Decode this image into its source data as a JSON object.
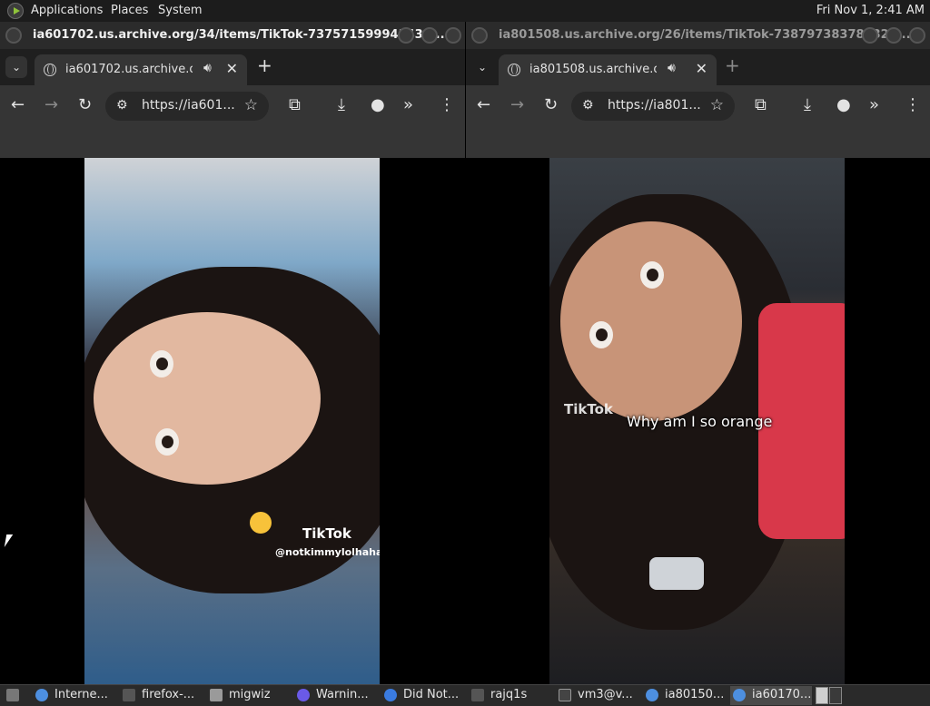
{
  "topbar": {
    "menus": [
      "Applications",
      "Places",
      "System"
    ],
    "clock": "Fri Nov 1, 2:41 AM"
  },
  "left_window": {
    "title": "ia601702.us.archive.org/34/items/TikTok-737571599941430...",
    "tab_label": "ia601702.us.archive.org/3",
    "url": "https://ia601...",
    "video": {
      "watermark": "TikTok",
      "handle": "@notkimmylolhaha"
    }
  },
  "right_window": {
    "title": "ia801508.us.archive.org/26/items/TikTok-738797383789324...",
    "tab_label": "ia801508.us.archive.org/",
    "url": "https://ia801...",
    "video": {
      "watermark": "TikTok",
      "caption": "Why am I so orange"
    }
  },
  "taskbar": {
    "items": [
      {
        "label": "Interne...",
        "icon": "chrome-icon"
      },
      {
        "label": "firefox-...",
        "icon": "terminal-icon"
      },
      {
        "label": "migwiz",
        "icon": "folder-icon"
      },
      {
        "label": "Warnin...",
        "icon": "firefox-icon"
      },
      {
        "label": "Did Not...",
        "icon": "firefox-icon"
      },
      {
        "label": "rajq1s",
        "icon": "terminal-icon"
      },
      {
        "label": "vm3@v...",
        "icon": "terminal-icon"
      },
      {
        "label": "ia80150...",
        "icon": "chrome-icon"
      },
      {
        "label": "ia60170...",
        "icon": "chrome-icon"
      }
    ]
  },
  "colors": {
    "panel": "#1c1c1c",
    "toolbar": "#353535",
    "accent_green": "#8fc43a"
  }
}
